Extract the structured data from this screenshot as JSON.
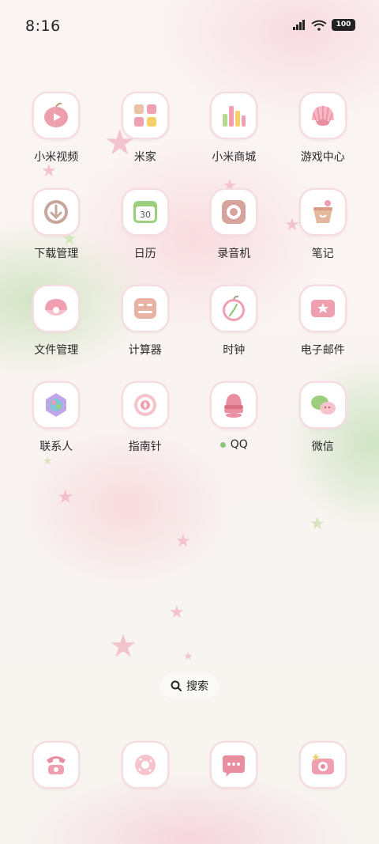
{
  "status_bar": {
    "time": "8:16",
    "battery": "100",
    "icons": [
      "signal-icon",
      "wifi-icon",
      "battery-icon"
    ]
  },
  "apps": [
    {
      "label": "小米视频",
      "icon": "video-icon"
    },
    {
      "label": "米家",
      "icon": "home-grid-icon"
    },
    {
      "label": "小米商城",
      "icon": "store-icon"
    },
    {
      "label": "游戏中心",
      "icon": "game-shell-icon"
    },
    {
      "label": "下载管理",
      "icon": "download-icon"
    },
    {
      "label": "日历",
      "icon": "calendar-icon",
      "day": "30"
    },
    {
      "label": "录音机",
      "icon": "recorder-icon"
    },
    {
      "label": "笔记",
      "icon": "notes-icon"
    },
    {
      "label": "文件管理",
      "icon": "file-manager-icon"
    },
    {
      "label": "计算器",
      "icon": "calculator-icon"
    },
    {
      "label": "时钟",
      "icon": "clock-icon"
    },
    {
      "label": "电子邮件",
      "icon": "email-icon"
    },
    {
      "label": "联系人",
      "icon": "contacts-icon"
    },
    {
      "label": "指南针",
      "icon": "compass-icon"
    },
    {
      "label": "QQ",
      "icon": "qq-icon",
      "notification_dot": "#8cc47a"
    },
    {
      "label": "微信",
      "icon": "wechat-icon"
    }
  ],
  "search": {
    "label": "搜索",
    "icon": "search-icon"
  },
  "dock": [
    {
      "icon": "phone-icon"
    },
    {
      "icon": "browser-icon"
    },
    {
      "icon": "messages-icon"
    },
    {
      "icon": "camera-icon"
    }
  ],
  "colors": {
    "icon_pink": "#f0a4b2",
    "icon_rose": "#e48796",
    "tile_border": "#f5dde1",
    "accent_green": "#8cc47a"
  }
}
